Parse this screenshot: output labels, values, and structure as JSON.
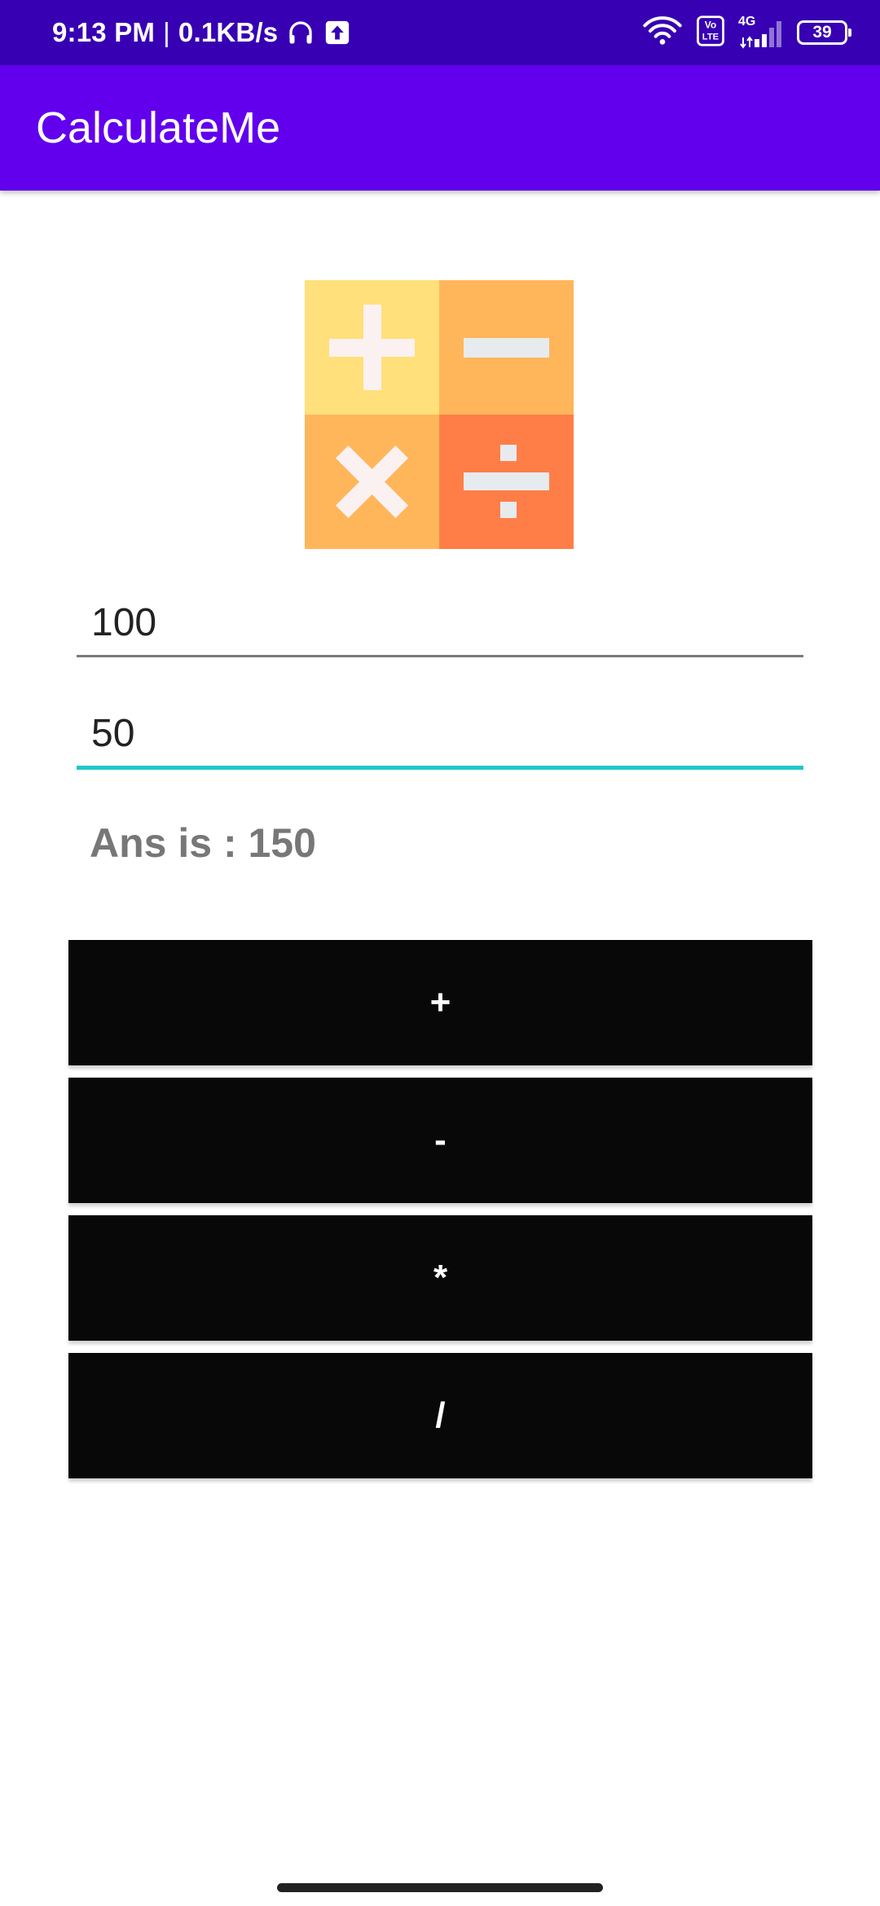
{
  "status_bar": {
    "time": "9:13 PM",
    "separator": "|",
    "net_speed": "0.1KB/s",
    "network_label": "4G",
    "volte_label": "Vo LTE",
    "battery_level": "39",
    "icons": [
      "headphones-icon",
      "upload-icon",
      "wifi-icon",
      "volte-icon",
      "signal-icon",
      "battery-icon"
    ],
    "background_color": "#3700b3"
  },
  "app_bar": {
    "title": "CalculateMe",
    "background_color": "#6200ee"
  },
  "logo": {
    "icon": "calculator-logo-icon",
    "symbols": [
      "+",
      "−",
      "×",
      "÷"
    ]
  },
  "inputs": {
    "first_number": "100",
    "second_number": "50",
    "focus_color": "#1ec8c8"
  },
  "answer": {
    "text": "Ans is : 150"
  },
  "buttons": {
    "add": "+",
    "subtract": "-",
    "multiply": "*",
    "divide": "/",
    "background_color": "#080808"
  }
}
